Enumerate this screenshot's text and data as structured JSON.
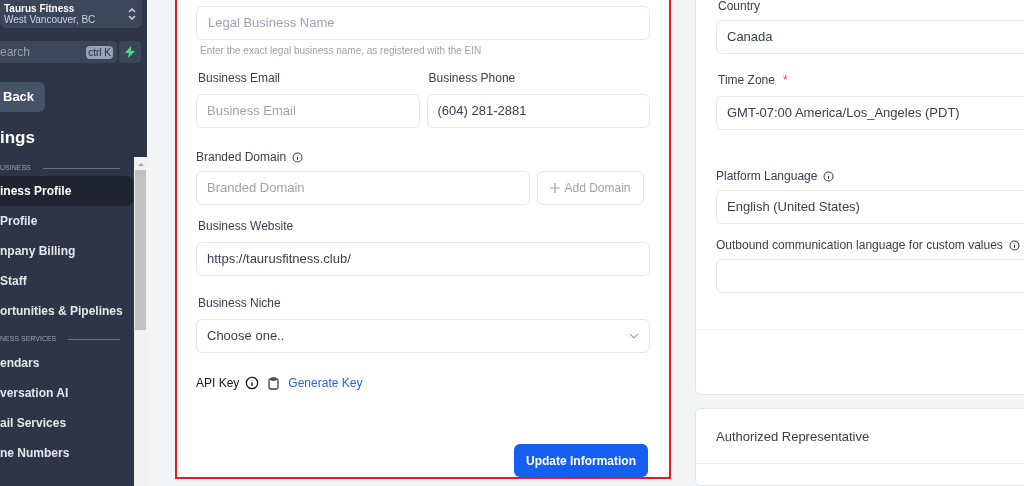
{
  "sidebar": {
    "account": {
      "name": "Taurus Fitness",
      "location": "West Vancouver, BC"
    },
    "search": {
      "placeholder": "earch",
      "shortcut": "ctrl K"
    },
    "back": "Back",
    "heading": "ings",
    "sections": [
      {
        "title": "USINESS",
        "items": [
          {
            "label": "iness Profile",
            "selected": true
          },
          {
            "label": "Profile",
            "selected": false
          },
          {
            "label": "npany Billing",
            "selected": false
          },
          {
            "label": "Staff",
            "selected": false
          },
          {
            "label": "ortunities & Pipelines",
            "selected": false
          }
        ]
      },
      {
        "title": "NESS SERVICES",
        "items": [
          {
            "label": "endars",
            "selected": false
          },
          {
            "label": "versation AI",
            "selected": false
          },
          {
            "label": "ail Services",
            "selected": false
          },
          {
            "label": "ne Numbers",
            "selected": false
          }
        ]
      }
    ]
  },
  "form": {
    "legal_name": {
      "placeholder": "Legal Business Name",
      "hint": "Enter the exact legal business name, as registered with the EIN"
    },
    "email": {
      "label": "Business Email",
      "placeholder": "Business Email"
    },
    "phone": {
      "label": "Business Phone",
      "value": "(604) 281-2881"
    },
    "domain": {
      "label": "Branded Domain",
      "placeholder": "Branded Domain",
      "button": "Add Domain"
    },
    "website": {
      "label": "Business Website",
      "value": "https://taurusfitness.club/"
    },
    "niche": {
      "label": "Business Niche",
      "value": "Choose one.."
    },
    "api_key": {
      "label": "API Key",
      "link": "Generate Key"
    },
    "submit": "Update Information"
  },
  "general": {
    "country": {
      "label": "Country",
      "value": "Canada"
    },
    "timezone": {
      "label": "Time Zone",
      "required": true,
      "required_mark": "*",
      "value": "GMT-07:00 America/Los_Angeles (PDT)"
    },
    "platform_language": {
      "label": "Platform Language",
      "value": "English (United States)"
    },
    "outbound_language": {
      "label": "Outbound communication language for custom values"
    }
  },
  "representative": {
    "title": "Authorized Representative"
  }
}
